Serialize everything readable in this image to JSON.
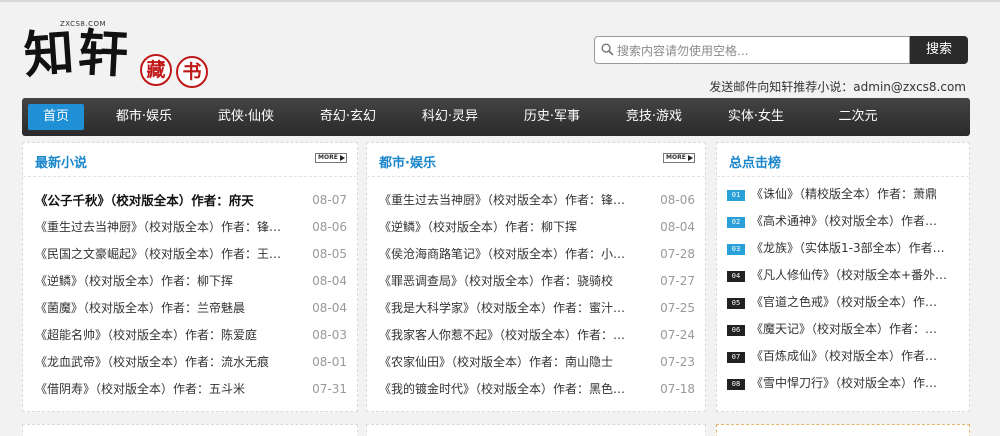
{
  "site": {
    "small_domain": "ZXCS8.COM",
    "logo_chars": [
      "知",
      "轩"
    ],
    "seal_chars": [
      "藏",
      "书"
    ]
  },
  "search": {
    "placeholder": "搜索内容请勿使用空格...",
    "button_label": "搜索",
    "recommend_text": "发送邮件向知轩推荐小说：admin@zxcs8.com"
  },
  "nav": {
    "items": [
      {
        "label": "首页",
        "active": true
      },
      {
        "label": "都市·娱乐"
      },
      {
        "label": "武侠·仙侠"
      },
      {
        "label": "奇幻·玄幻"
      },
      {
        "label": "科幻·灵异"
      },
      {
        "label": "历史·军事"
      },
      {
        "label": "竞技·游戏"
      },
      {
        "label": "实体·女生"
      },
      {
        "label": "二次元"
      }
    ]
  },
  "panels": {
    "latest": {
      "title": "最新小说",
      "more_label": "MORE",
      "rows": [
        {
          "title": "《公子千秋》（校对版全本）作者：府天",
          "date": "08-07"
        },
        {
          "title": "《重生过去当神厨》（校对版全本）作者：锋…",
          "date": "08-06"
        },
        {
          "title": "《民国之文豪崛起》（校对版全本）作者：王…",
          "date": "08-05"
        },
        {
          "title": "《逆鳞》（校对版全本）作者：柳下挥",
          "date": "08-04"
        },
        {
          "title": "《菌魔》（校对版全本）作者：兰帝魅晨",
          "date": "08-04"
        },
        {
          "title": "《超能名帅》（校对版全本）作者：陈爱庭",
          "date": "08-03"
        },
        {
          "title": "《龙血武帝》（校对版全本）作者：流水无痕",
          "date": "08-01"
        },
        {
          "title": "《借阴寿》（校对版全本）作者：五斗米",
          "date": "07-31"
        }
      ]
    },
    "urban": {
      "title": "都市·娱乐",
      "more_label": "MORE",
      "rows": [
        {
          "title": "《重生过去当神厨》（校对版全本）作者：锋…",
          "date": "08-06"
        },
        {
          "title": "《逆鳞》（校对版全本）作者：柳下挥",
          "date": "08-04"
        },
        {
          "title": "《侯沧海商路笔记》（校对版全本）作者：小…",
          "date": "07-28"
        },
        {
          "title": "《罪恶调查局》（校对版全本）作者：骁骑校",
          "date": "07-27"
        },
        {
          "title": "《我是大科学家》（校对版全本）作者：蜜汁…",
          "date": "07-25"
        },
        {
          "title": "《我家客人你惹不起》（校对版全本）作者：…",
          "date": "07-24"
        },
        {
          "title": "《农家仙田》（校对版全本）作者：南山隐士",
          "date": "07-23"
        },
        {
          "title": "《我的镀金时代》（校对版全本）作者：黑色…",
          "date": "07-18"
        }
      ]
    },
    "rank": {
      "title": "总点击榜",
      "rows": [
        {
          "num": "01",
          "title": "《诛仙》（精校版全本）作者：萧鼎"
        },
        {
          "num": "02",
          "title": "《高术通神》（校对版全本）作者…"
        },
        {
          "num": "03",
          "title": "《龙族》（实体版1-3部全本）作者…"
        },
        {
          "num": "04",
          "title": "《凡人修仙传》（校对版全本+番外…"
        },
        {
          "num": "05",
          "title": "《官道之色戒》（校对版全本）作…"
        },
        {
          "num": "06",
          "title": "《魔天记》（校对版全本）作者：…"
        },
        {
          "num": "07",
          "title": "《百炼成仙》（校对版全本）作者…"
        },
        {
          "num": "08",
          "title": "《雪中悍刀行》（校对版全本）作…"
        }
      ]
    }
  }
}
